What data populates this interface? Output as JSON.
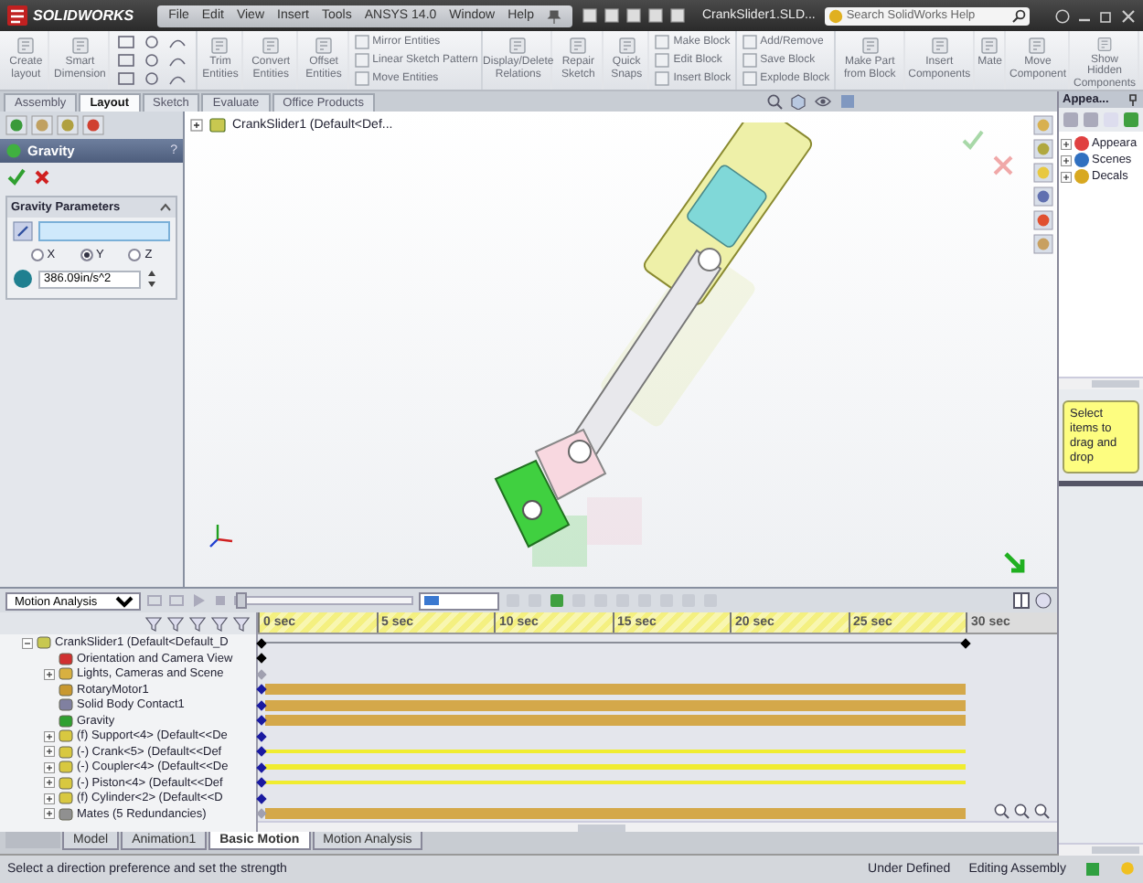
{
  "app": {
    "logo": "SOLIDWORKS",
    "menu": [
      "File",
      "Edit",
      "View",
      "Insert",
      "Tools",
      "ANSYS 14.0",
      "Window",
      "Help"
    ],
    "document_title": "CrankSlider1.SLD...",
    "search": {
      "placeholder": "Search SolidWorks Help"
    }
  },
  "ribbon": [
    {
      "kind": "large",
      "label": "Create layout"
    },
    {
      "kind": "large",
      "label": "Smart Dimension"
    },
    {
      "kind": "sketch_tools"
    },
    {
      "kind": "large",
      "label": "Trim Entities"
    },
    {
      "kind": "large",
      "label": "Convert Entities"
    },
    {
      "kind": "large",
      "label": "Offset Entities"
    },
    {
      "kind": "stack",
      "items": [
        "Mirror Entities",
        "Linear Sketch Pattern",
        "Move Entities"
      ]
    },
    {
      "kind": "large",
      "label": "Display/Delete Relations"
    },
    {
      "kind": "large",
      "label": "Repair Sketch"
    },
    {
      "kind": "large",
      "label": "Quick Snaps"
    },
    {
      "kind": "stack",
      "items": [
        "Make Block",
        "Edit Block",
        "Insert Block"
      ]
    },
    {
      "kind": "stack",
      "items": [
        "Add/Remove",
        "Save Block",
        "Explode Block"
      ]
    },
    {
      "kind": "large",
      "label": "Make Part from Block"
    },
    {
      "kind": "large",
      "label": "Insert Components"
    },
    {
      "kind": "large",
      "label": "Mate"
    },
    {
      "kind": "large",
      "label": "Move Component"
    },
    {
      "kind": "large",
      "label": "Show Hidden Components"
    }
  ],
  "command_tabs": [
    {
      "label": "Assembly",
      "selected": false
    },
    {
      "label": "Layout",
      "selected": true
    },
    {
      "label": "Sketch",
      "selected": false
    },
    {
      "label": "Evaluate",
      "selected": false
    },
    {
      "label": "Office Products",
      "selected": false
    }
  ],
  "property_manager": {
    "title": "Gravity",
    "help": "?",
    "group_title": "Gravity Parameters",
    "direction_options": [
      {
        "label": "X",
        "selected": false
      },
      {
        "label": "Y",
        "selected": true
      },
      {
        "label": "Z",
        "selected": false
      }
    ],
    "gravity_value": "386.09in/s^2"
  },
  "viewport": {
    "tree_root": "CrankSlider1  (Default<Def..."
  },
  "task_pane": {
    "title": "Appea...",
    "items": [
      "Appeara",
      "Scenes",
      "Decals"
    ],
    "note": "Select items to drag and drop"
  },
  "motion": {
    "study_type": "Motion Analysis",
    "slider": {
      "level": 0
    },
    "ruler": [
      "0 sec",
      "5 sec",
      "10 sec",
      "15 sec",
      "20 sec",
      "25 sec",
      "30 sec"
    ],
    "rows": [
      {
        "label": "CrankSlider1  (Default<Default_D",
        "expanded": true,
        "kind": "line",
        "color": "#000000"
      },
      {
        "label": "Orientation and Camera View",
        "kind": "plain",
        "color": "#000000"
      },
      {
        "label": "Lights, Cameras and Scene",
        "expanded": false,
        "kind": "plain",
        "color": "#a0a0b0"
      },
      {
        "label": "RotaryMotor1",
        "kind": "thick",
        "color": "#1a1aa0"
      },
      {
        "label": "Solid Body Contact1",
        "kind": "thick",
        "color": "#1a1aa0"
      },
      {
        "label": "Gravity",
        "kind": "thick",
        "color": "#1a1aa0"
      },
      {
        "label": "(f) Support<4>  (Default<<De",
        "expanded": false,
        "kind": "plain",
        "color": "#1a1aa0"
      },
      {
        "label": "(-) Crank<5>  (Default<<Def",
        "expanded": false,
        "kind": "thin",
        "color": "#1a1aa0"
      },
      {
        "label": "(-) Coupler<4>  (Default<<De",
        "expanded": false,
        "kind": "thin",
        "color": "#1a1aa0"
      },
      {
        "label": "(-) Piston<4>  (Default<<Def",
        "expanded": false,
        "kind": "thin",
        "color": "#1a1aa0"
      },
      {
        "label": "(f) Cylinder<2>  (Default<<D",
        "expanded": false,
        "kind": "plain",
        "color": "#1a1aa0"
      },
      {
        "label": "Mates (5 Redundancies)",
        "expanded": false,
        "kind": "thick",
        "color": "#a0a0b0"
      }
    ]
  },
  "study_tabs": [
    {
      "label": "Model",
      "selected": false
    },
    {
      "label": "Animation1",
      "selected": false
    },
    {
      "label": "Basic Motion",
      "selected": true
    },
    {
      "label": "Motion Analysis",
      "selected": false
    }
  ],
  "status_bar": {
    "message": "Select a direction preference and set the strength",
    "state": "Under Defined",
    "mode": "Editing Assembly"
  }
}
